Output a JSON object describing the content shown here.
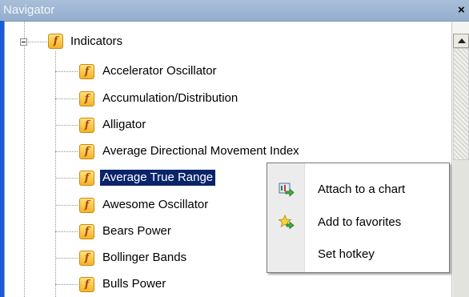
{
  "window": {
    "title": "Navigator",
    "close_glyph": "×"
  },
  "tree": {
    "root": {
      "label": "Indicators",
      "icon": "indicator-icon",
      "expanded": true
    },
    "items": [
      {
        "label": "Accelerator Oscillator",
        "icon": "indicator-icon"
      },
      {
        "label": "Accumulation/Distribution",
        "icon": "indicator-icon"
      },
      {
        "label": "Alligator",
        "icon": "indicator-icon"
      },
      {
        "label": "Average Directional Movement Index",
        "icon": "indicator-icon"
      },
      {
        "label": "Average True Range",
        "icon": "indicator-icon",
        "selected": true
      },
      {
        "label": "Awesome Oscillator",
        "icon": "indicator-icon"
      },
      {
        "label": "Bears Power",
        "icon": "indicator-icon"
      },
      {
        "label": "Bollinger Bands",
        "icon": "indicator-icon"
      },
      {
        "label": "Bulls Power",
        "icon": "indicator-icon"
      }
    ],
    "icon_glyph": "f"
  },
  "context_menu": {
    "items": [
      {
        "label": "Attach to a chart",
        "icon": "attach-chart-icon"
      },
      {
        "label": "Add to favorites",
        "icon": "star-add-icon"
      },
      {
        "label": "Set hotkey",
        "icon": ""
      }
    ]
  },
  "colors": {
    "selection_bg": "#0a246a",
    "selection_fg": "#ffffff",
    "title_bar": "#a9bfd9",
    "frame": "#1a5ad6",
    "icon_fill": "#f3b428",
    "icon_glyph": "#b3400a"
  }
}
